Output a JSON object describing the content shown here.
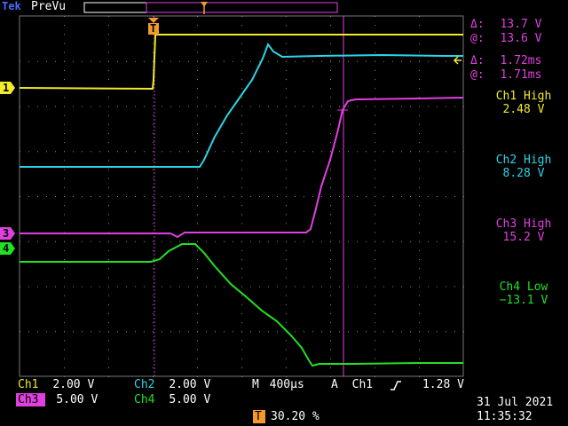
{
  "header": {
    "brand": "Tek",
    "mode": "PreVu",
    "trigger_pos_icon": "trigger-position-marker-icon"
  },
  "cursor_readout": {
    "delta_v_symbol": "Δ:",
    "delta_v": "13.7 V",
    "at_v_symbol": "@:",
    "at_v": "13.6 V",
    "delta_t_symbol": "Δ:",
    "delta_t": "1.72ms",
    "at_t_symbol": "@:",
    "at_t": "1.71ms"
  },
  "measurements": [
    {
      "label": "Ch1 High",
      "value": "2.48 V",
      "color": "#f2ea2c"
    },
    {
      "label": "Ch2 High",
      "value": "8.28 V",
      "color": "#2cd5e6"
    },
    {
      "label": "Ch3 High",
      "value": "15.2 V",
      "color": "#e040e0"
    },
    {
      "label": "Ch4 Low",
      "value": "−13.1 V",
      "color": "#22e022"
    }
  ],
  "channel_markers": {
    "ch1": "1",
    "ch3": "3",
    "ch4": "4",
    "trigger": "T"
  },
  "status": {
    "ch1_label": "Ch1",
    "ch1_scale": "2.00 V",
    "ch2_label": "Ch2",
    "ch2_scale": "2.00 V",
    "ch3_label": "Ch3",
    "ch3_scale": "5.00 V",
    "ch4_label": "Ch4",
    "ch4_scale": "5.00 V",
    "timebase_label": "M",
    "timebase": "400µs",
    "trigger_mode": "A",
    "trigger_source": "Ch1",
    "trigger_slope_icon": "rising-edge-icon",
    "trigger_level": "1.28 V",
    "position_label": "T",
    "position": "30.20 %",
    "date": "31 Jul  2021",
    "time": "11:35:32"
  },
  "colors": {
    "ch1": "#f2ea2c",
    "ch2": "#2cd5e6",
    "ch3": "#e040e0",
    "ch4": "#22e022",
    "grid": "#8a8a8a"
  }
}
